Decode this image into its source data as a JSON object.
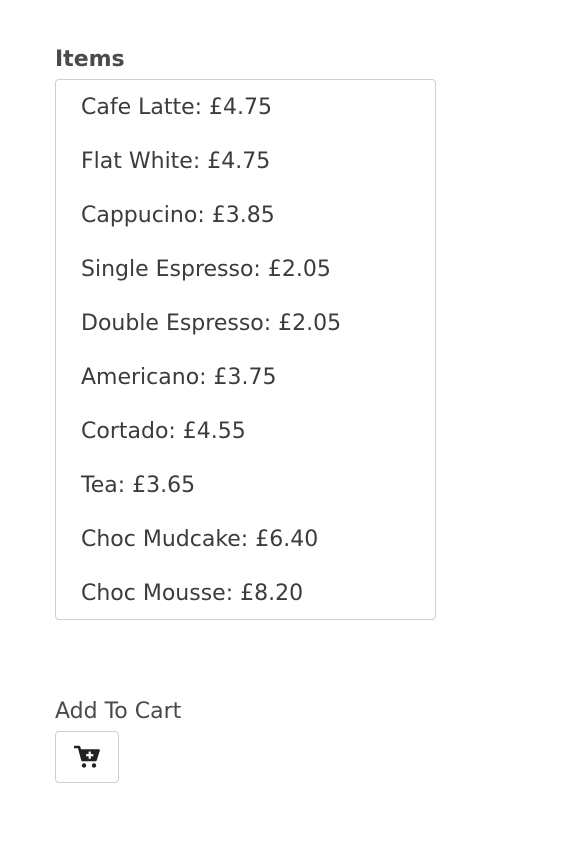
{
  "items_section": {
    "label": "Items",
    "options": [
      {
        "label": "Cafe Latte: £4.75"
      },
      {
        "label": "Flat White: £4.75"
      },
      {
        "label": "Cappucino: £3.85"
      },
      {
        "label": "Single Espresso: £2.05"
      },
      {
        "label": "Double Espresso: £2.05"
      },
      {
        "label": "Americano: £3.75"
      },
      {
        "label": "Cortado: £4.55"
      },
      {
        "label": "Tea: £3.65"
      },
      {
        "label": "Choc Mudcake: £6.40"
      },
      {
        "label": "Choc Mousse: £8.20"
      }
    ]
  },
  "cart": {
    "label": "Add To Cart",
    "button_icon": "cart-plus-icon"
  }
}
